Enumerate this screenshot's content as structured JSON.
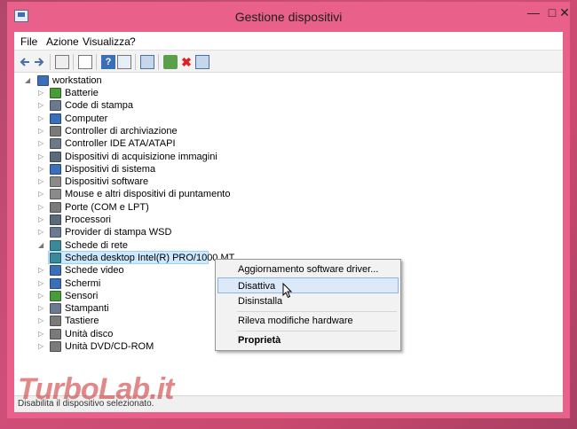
{
  "window": {
    "title": "Gestione dispositivi"
  },
  "menubar": {
    "items": [
      "File",
      "Azione",
      "Visualizza",
      "?"
    ]
  },
  "toolbar": {
    "icons": [
      "back-icon",
      "forward-icon",
      "view-icon",
      "properties-icon",
      "help-icon",
      "refresh-icon",
      "computer-icon",
      "update-driver-icon",
      "uninstall-icon",
      "scan-hardware-icon"
    ]
  },
  "tree": {
    "root": "workstation",
    "items": [
      {
        "label": "Batterie",
        "icon": "battery-icon",
        "color": "#4a9c3a"
      },
      {
        "label": "Code di stampa",
        "icon": "printer-icon",
        "color": "#6b7a8f"
      },
      {
        "label": "Computer",
        "icon": "computer-icon",
        "color": "#3b6fb8"
      },
      {
        "label": "Controller di archiviazione",
        "icon": "storage-controller-icon",
        "color": "#7a7a7a"
      },
      {
        "label": "Controller IDE ATA/ATAPI",
        "icon": "ide-controller-icon",
        "color": "#6a7a88"
      },
      {
        "label": "Dispositivi di acquisizione immagini",
        "icon": "camera-icon",
        "color": "#5a6a7a"
      },
      {
        "label": "Dispositivi di sistema",
        "icon": "system-device-icon",
        "color": "#3b6fb8"
      },
      {
        "label": "Dispositivi software",
        "icon": "software-device-icon",
        "color": "#8a8a8a"
      },
      {
        "label": "Mouse e altri dispositivi di puntamento",
        "icon": "mouse-icon",
        "color": "#8a8a8a"
      },
      {
        "label": "Porte (COM e LPT)",
        "icon": "port-icon",
        "color": "#7a7a7a"
      },
      {
        "label": "Processori",
        "icon": "processor-icon",
        "color": "#5a6a7a"
      },
      {
        "label": "Provider di stampa WSD",
        "icon": "wsd-printer-icon",
        "color": "#6b7a8f"
      },
      {
        "label": "Schede di rete",
        "icon": "network-adapter-icon",
        "color": "#3b8a9a",
        "expanded": true
      },
      {
        "label": "Scheda desktop Intel(R) PRO/1000 MT",
        "icon": "network-card-icon",
        "color": "#3b8a9a",
        "child": true,
        "selected": true
      },
      {
        "label": "Schede video",
        "icon": "display-adapter-icon",
        "color": "#3b6fb8"
      },
      {
        "label": "Schermi",
        "icon": "monitor-icon",
        "color": "#3b6fb8"
      },
      {
        "label": "Sensori",
        "icon": "sensor-icon",
        "color": "#4a9c3a"
      },
      {
        "label": "Stampanti",
        "icon": "printer-icon",
        "color": "#6b7a8f"
      },
      {
        "label": "Tastiere",
        "icon": "keyboard-icon",
        "color": "#7a7a7a"
      },
      {
        "label": "Unità disco",
        "icon": "disk-drive-icon",
        "color": "#7a7a7a"
      },
      {
        "label": "Unità DVD/CD-ROM",
        "icon": "dvd-drive-icon",
        "color": "#7a7a7a"
      }
    ]
  },
  "context_menu": {
    "items": [
      {
        "label": "Aggiornamento software driver..."
      },
      {
        "label": "Disattiva",
        "highlighted": true
      },
      {
        "label": "Disinstalla"
      },
      {
        "label": "Rileva modifiche hardware"
      },
      {
        "label": "Proprietà",
        "bold": true
      }
    ]
  },
  "status": {
    "text": "Disabilita il dispositivo selezionato."
  },
  "watermark": {
    "text": "TurboLab.it"
  },
  "colors": {
    "titlebar": "#e9608a",
    "selection": "#cde8ff",
    "menu_highlight": "#dbe9f8"
  }
}
